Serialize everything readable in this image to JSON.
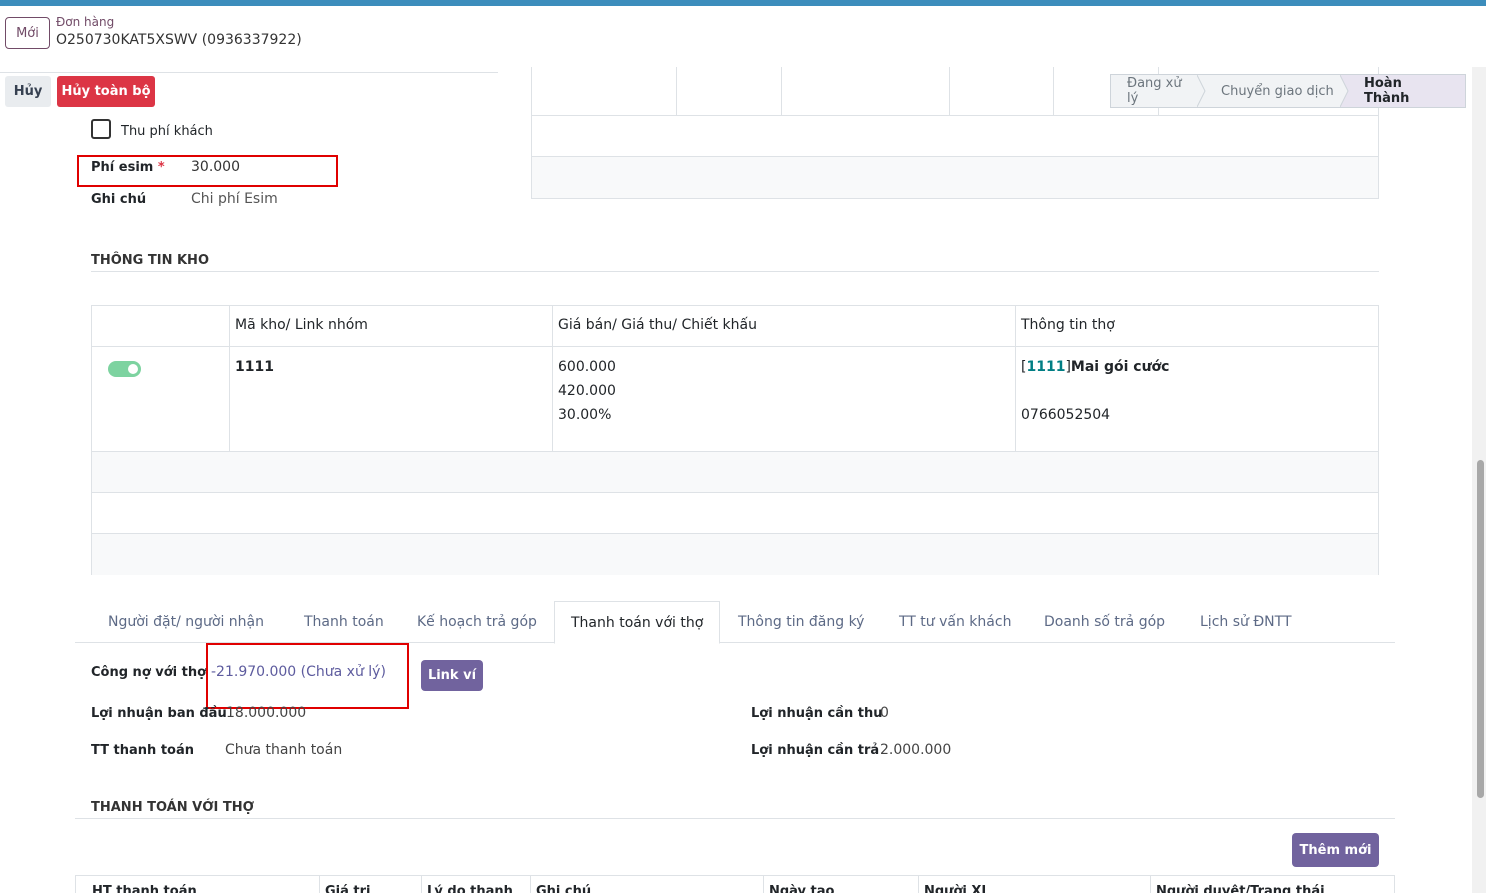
{
  "header": {
    "new_button": "Mới",
    "breadcrumb_label": "Đơn hàng",
    "record_title": "O250730KAT5XSWV (0936337922)"
  },
  "actions": {
    "cancel": "Hủy",
    "cancel_all": "Hủy toàn bộ"
  },
  "statusbar": {
    "steps": [
      "Đang xử lý",
      "Chuyển giao dịch",
      "Hoàn Thành"
    ],
    "active": "Hoàn Thành"
  },
  "form_top": {
    "customer_fee_label": "Thu phí khách",
    "customer_fee_checked": false,
    "esim_fee_label": "Phí esim",
    "esim_fee_required": "*",
    "esim_fee_value": "30.000",
    "note_label": "Ghi chú",
    "note_value": "Chi phí Esim"
  },
  "warehouse": {
    "section_title": "THÔNG TIN KHO",
    "columns": [
      "",
      "Mã kho/ Link nhóm",
      "Giá bán/ Giá thu/ Chiết khấu",
      "Thông tin thợ"
    ],
    "row": {
      "active": true,
      "code": "1111",
      "sell_price": "600.000",
      "collect_price": "420.000",
      "discount": "30.00%",
      "tech_bracket_open": "[",
      "tech_code": "1111",
      "tech_bracket_close": "]",
      "tech_name": "Mai gói cước",
      "tech_phone": "0766052504"
    }
  },
  "tabs": {
    "items": [
      "Người đặt/ người nhận",
      "Thanh toán",
      "Kế hoạch trả góp",
      "Thanh toán với thợ",
      "Thông tin đăng ký",
      "TT tư vấn khách",
      "Doanh số trả góp",
      "Lịch sử ĐNTT"
    ],
    "active": "Thanh toán với thợ"
  },
  "tech_payment": {
    "debt_label": "Công nợ với thợ",
    "debt_value": "-21.970.000 (Chưa xử lý)",
    "link_wallet": "Link ví",
    "initial_profit_label": "Lợi nhuận ban đầu",
    "initial_profit_value": "18.000.000",
    "pay_status_label": "TT thanh toán",
    "pay_status_value": "Chưa thanh toán",
    "profit_collect_label": "Lợi nhuận cần thu",
    "profit_collect_value": "0",
    "profit_pay_label": "Lợi nhuận cần trả",
    "profit_pay_value": "2.000.000",
    "section_title": "THANH TOÁN VỚI THỢ",
    "add_new": "Thêm mới",
    "table_headers": [
      "HT thanh toán",
      "Giá trị",
      "Lý do thanh",
      "Ghi chú",
      "Ngày tạo",
      "Người XL",
      "Người duyệt/Trạng thái"
    ]
  }
}
